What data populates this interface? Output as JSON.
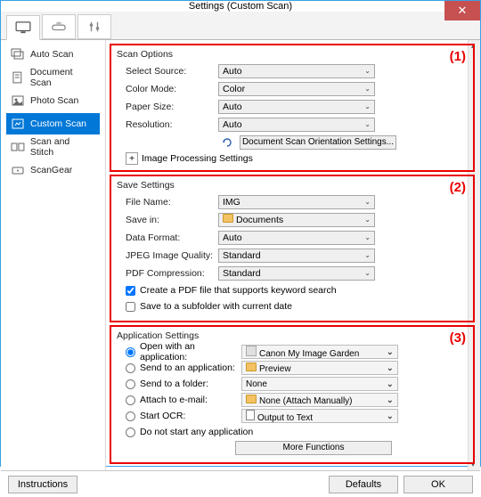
{
  "window_title": "Settings (Custom Scan)",
  "sidebar": {
    "items": [
      {
        "label": "Auto Scan"
      },
      {
        "label": "Document Scan"
      },
      {
        "label": "Photo Scan"
      },
      {
        "label": "Custom Scan"
      },
      {
        "label": "Scan and Stitch"
      },
      {
        "label": "ScanGear"
      }
    ]
  },
  "panel1": {
    "num": "(1)",
    "title": "Scan Options",
    "select_source_label": "Select Source:",
    "select_source_value": "Auto",
    "color_mode_label": "Color Mode:",
    "color_mode_value": "Color",
    "paper_size_label": "Paper Size:",
    "paper_size_value": "Auto",
    "resolution_label": "Resolution:",
    "resolution_value": "Auto",
    "orientation_btn": "Document Scan Orientation Settings...",
    "image_proc": "Image Processing Settings"
  },
  "panel2": {
    "num": "(2)",
    "title": "Save Settings",
    "file_name_label": "File Name:",
    "file_name_value": "IMG",
    "save_in_label": "Save in:",
    "save_in_value": "Documents",
    "data_format_label": "Data Format:",
    "data_format_value": "Auto",
    "jpeg_label": "JPEG Image Quality:",
    "jpeg_value": "Standard",
    "pdf_label": "PDF Compression:",
    "pdf_value": "Standard",
    "chk_keyword": "Create a PDF file that supports keyword search",
    "chk_subfolder": "Save to a subfolder with current date"
  },
  "panel3": {
    "num": "(3)",
    "title": "Application Settings",
    "r_open_app": "Open with an application:",
    "r_open_app_val": "Canon My Image Garden",
    "r_send_app": "Send to an application:",
    "r_send_app_val": "Preview",
    "r_send_folder": "Send to a folder:",
    "r_send_folder_val": "None",
    "r_email": "Attach to e-mail:",
    "r_email_val": "None (Attach Manually)",
    "r_ocr": "Start OCR:",
    "r_ocr_val": "Output to Text",
    "r_none": "Do not start any application",
    "more_fn": "More Functions"
  },
  "footer": {
    "instructions": "Instructions",
    "defaults": "Defaults",
    "ok": "OK"
  }
}
